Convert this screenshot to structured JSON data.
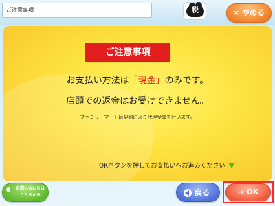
{
  "header": {
    "title": "ご注意事項",
    "tax_char": "税",
    "cancel_label": "× やめる"
  },
  "notice": {
    "heading": "ご注意事項",
    "line1_before": "お支払い方法は",
    "line1_highlight": "「現金」",
    "line1_after": "のみです。",
    "line2": "店頭での返金はお受けできません。",
    "line3": "ファミリーマートは契約により代理受領を行います。",
    "guide": "OKボタンを押してお支払いへお進みください"
  },
  "footer": {
    "inquiry_label_1": "お問い合わせは",
    "inquiry_label_2": "こちらから",
    "back_label": "戻る",
    "ok_label": "→ OK"
  },
  "colors": {
    "highlight_red": "#e01515",
    "ok_orange": "#f05a3c",
    "back_blue": "#4f6fd8",
    "cancel_orange": "#f2842d",
    "inquiry_green": "#5fb92f"
  }
}
